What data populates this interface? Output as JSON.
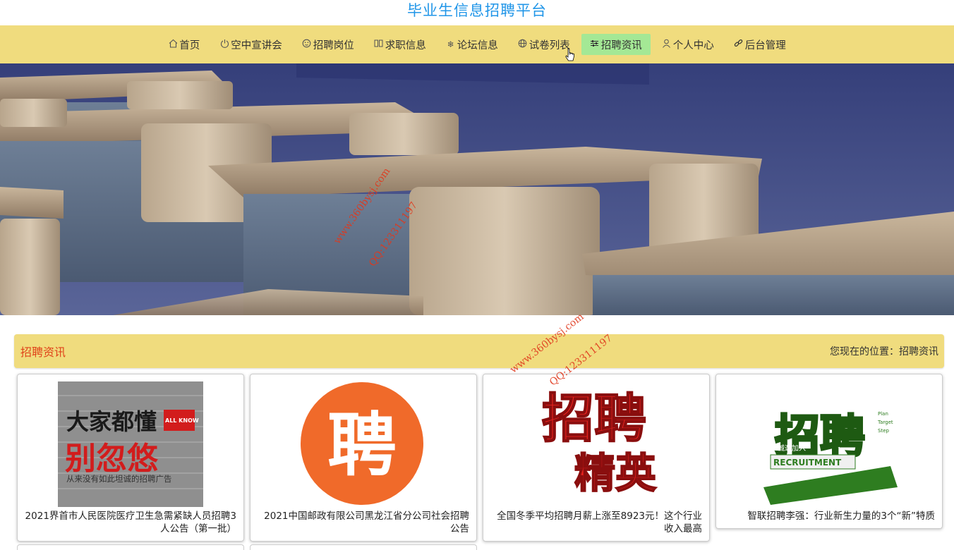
{
  "site": {
    "title": "毕业生信息招聘平台"
  },
  "nav": {
    "items": [
      {
        "icon": "home-icon",
        "label": "首页"
      },
      {
        "icon": "power-icon",
        "label": "空中宣讲会"
      },
      {
        "icon": "face-icon",
        "label": "招聘岗位"
      },
      {
        "icon": "columns-icon",
        "label": "求职信息"
      },
      {
        "icon": "snowflake-icon",
        "label": "论坛信息"
      },
      {
        "icon": "globe-icon",
        "label": "试卷列表"
      },
      {
        "icon": "sliders-icon",
        "label": "招聘资讯"
      },
      {
        "icon": "user-icon",
        "label": "个人中心"
      },
      {
        "icon": "link-icon",
        "label": "后台管理"
      }
    ],
    "active_index": 6
  },
  "banner": {
    "slide_count": 3,
    "active_slide": 1
  },
  "section": {
    "title": "招聘资讯",
    "location": "您现在的位置：招聘资讯"
  },
  "cards": [
    {
      "title": "2021界首市人民医院医疗卫生急需紧缺人员招聘3人公告（第一批）",
      "image_text": [
        "大家都懂",
        "别忽悠",
        "ALL KNOW",
        "从来没有如此坦诚的招聘广告"
      ]
    },
    {
      "title": "2021中国邮政有限公司黑龙江省分公司社会招聘公告",
      "image_text": [
        "聘"
      ]
    },
    {
      "title": "全国冬季平均招聘月薪上涨至8923元！这个行业收入最高",
      "image_text": [
        "招聘",
        "精英"
      ]
    },
    {
      "title": "智联招聘李强：行业新生力量的3个“新”特质",
      "image_text": [
        "招聘",
        "诚邀加入",
        "RECRUITMENT",
        "Plan",
        "Target",
        "Step"
      ]
    }
  ],
  "watermarks": [
    "www.360bysj.com",
    "QQ:123311197"
  ],
  "colors": {
    "nav_bg": "#f0dc7e",
    "active_nav": "#a4e895",
    "title_blue": "#2196e8",
    "section_red": "#e0431a"
  }
}
